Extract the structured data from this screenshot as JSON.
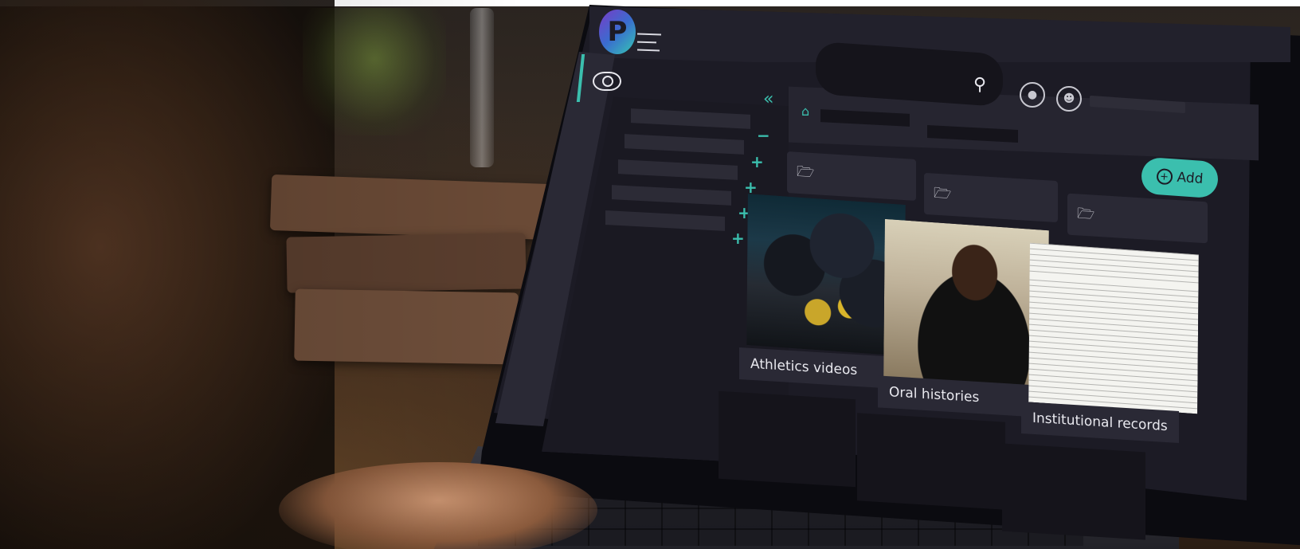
{
  "app": {
    "logo_letter": "P"
  },
  "main": {
    "add_label": "Add",
    "collections": [
      {
        "label": "Athletics videos"
      },
      {
        "label": "Oral histories"
      },
      {
        "label": "Institutional records"
      }
    ]
  },
  "icons": {
    "menu": "hamburger-icon",
    "search": "search-icon",
    "eye": "eye-icon",
    "collapse": "double-chevron-left-icon",
    "home": "home-icon",
    "folder": "folder-icon",
    "notifications": "bell-icon",
    "user": "user-icon"
  },
  "colors": {
    "accent": "#3bbfae",
    "background": "#1c1b25",
    "panel": "#2a2935"
  }
}
